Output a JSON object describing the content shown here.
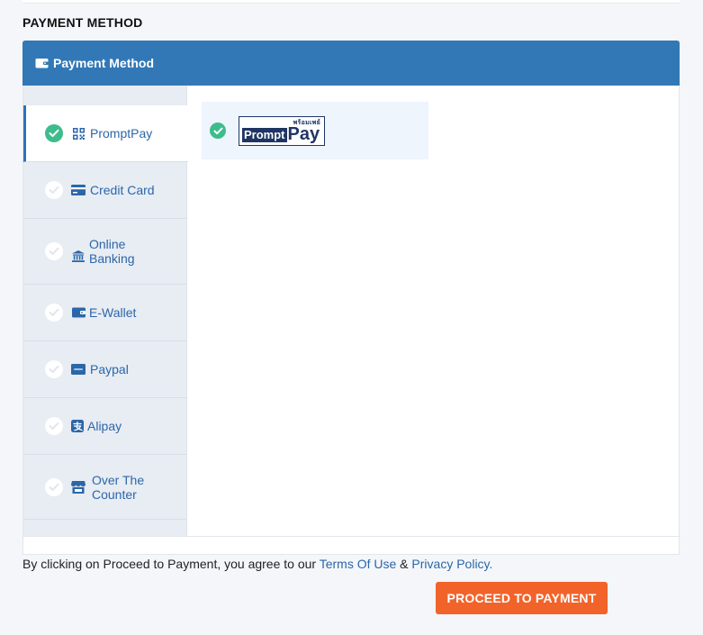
{
  "section_title": "PAYMENT METHOD",
  "panel": {
    "header_title": "Payment Method"
  },
  "tabs": [
    {
      "label": "PromptPay",
      "icon": "qr-code-icon",
      "active": true
    },
    {
      "label": "Credit Card",
      "icon": "credit-card-icon",
      "active": false
    },
    {
      "label": "Online Banking",
      "icon": "bank-icon",
      "active": false
    },
    {
      "label": "E-Wallet",
      "icon": "wallet-icon",
      "active": false
    },
    {
      "label": "Paypal",
      "icon": "paypal-icon",
      "active": false
    },
    {
      "label": "Alipay",
      "icon": "alipay-icon",
      "active": false
    },
    {
      "label": "Over The Counter",
      "icon": "store-icon",
      "active": false
    }
  ],
  "selected_option": {
    "logo_prompt": "Prompt",
    "logo_pay": "Pay",
    "logo_thai": "พร้อมเพย์"
  },
  "footer": {
    "agree_prefix": "By clicking on Proceed to Payment, you agree to our ",
    "terms_link": "Terms Of Use",
    "amp": " & ",
    "privacy_link": "Privacy Policy.",
    "proceed_label": "PROCEED TO PAYMENT"
  },
  "colors": {
    "header_blue": "#3278b6",
    "check_green": "#3dbd8c",
    "link_blue": "#2b67a8",
    "button_orange": "#f2632a"
  }
}
